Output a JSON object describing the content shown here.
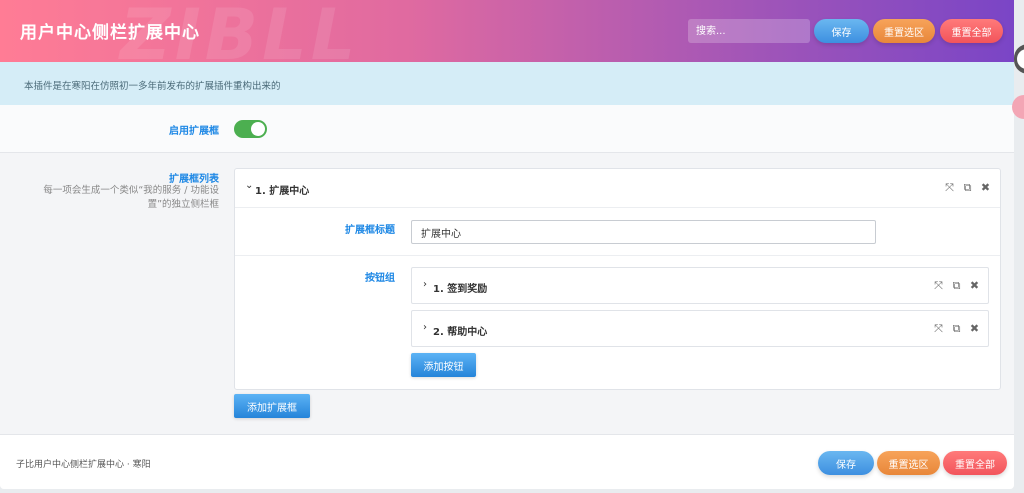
{
  "header": {
    "title": "用户中心侧栏扩展中心",
    "watermark": "ZIBLL",
    "search_placeholder": "搜索...",
    "save_label": "保存",
    "reset_section_label": "重置选区",
    "reset_all_label": "重置全部"
  },
  "notice": {
    "text": "本插件是在寒阳在仿照初一多年前发布的扩展插件重构出来的"
  },
  "fields": {
    "enable_label": "启用扩展框",
    "enable_on": true,
    "list_label": "扩展框列表",
    "list_desc": "每一项会生成一个类似“我的服务 / 功能设置”的独立侧栏框"
  },
  "group": {
    "title": "1. 扩展中心",
    "title_field_label": "扩展框标题",
    "title_field_value": "扩展中心",
    "buttons_label": "按钮组",
    "buttons": [
      {
        "title": "1. 签到奖励"
      },
      {
        "title": "2. 帮助中心"
      }
    ],
    "add_button_label": "添加按钮"
  },
  "add_box_label": "添加扩展框",
  "footer": {
    "credit": "子比用户中心侧栏扩展中心 · 寒阳",
    "save_label": "保存",
    "reset_section_label": "重置选区",
    "reset_all_label": "重置全部"
  }
}
